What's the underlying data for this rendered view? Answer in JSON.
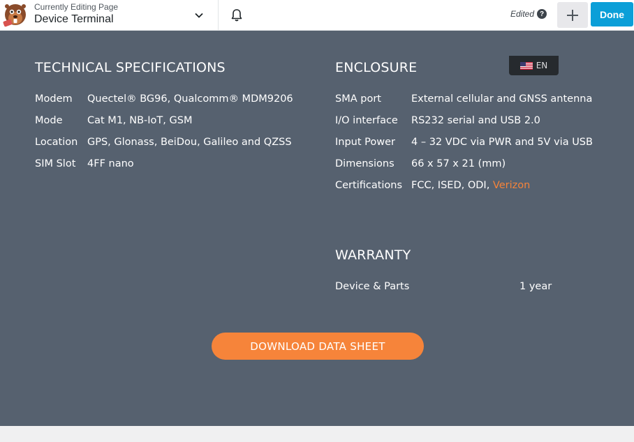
{
  "editor": {
    "currently_editing": "Currently Editing Page",
    "page_title": "Device Terminal",
    "edited_label": "Edited",
    "help_glyph": "?",
    "done_label": "Done",
    "language": "EN",
    "icons": [
      "beaver-logo-icon",
      "chevron-down-icon",
      "bell-icon",
      "help-icon",
      "plus-icon",
      "us-flag-icon"
    ],
    "colors": {
      "done_bg": "#0b9fd8",
      "content_bg": "#56616f",
      "accent": "#f6843a"
    }
  },
  "tech": {
    "heading": "TECHNICAL SPECIFICATIONS",
    "rows": [
      {
        "label": "Modem",
        "value": "Quectel® BG96, Qualcomm® MDM9206"
      },
      {
        "label": "Mode",
        "value": "Cat M1, NB-IoT, GSM"
      },
      {
        "label": "Location",
        "value": "GPS, Glonass, BeiDou, Galileo and QZSS"
      },
      {
        "label": "SIM Slot",
        "value": "4FF nano"
      }
    ]
  },
  "enclosure": {
    "heading": "ENCLOSURE",
    "rows": [
      {
        "label": "SMA port",
        "value": "External cellular and GNSS antenna"
      },
      {
        "label": "I/O interface",
        "value": "RS232 serial and USB 2.0"
      },
      {
        "label": "Input Power",
        "value": "4 – 32 VDC via PWR and 5V via USB"
      },
      {
        "label": "Dimensions",
        "value": "66 x 57 x 21 (mm)"
      },
      {
        "label": "Certifications",
        "value": "FCC, ISED, ODI, ",
        "link": "Verizon"
      }
    ]
  },
  "warranty": {
    "heading": "WARRANTY",
    "rows": [
      {
        "label": "Device & Parts",
        "value": "1 year"
      }
    ]
  },
  "download_label": "DOWNLOAD DATA SHEET"
}
